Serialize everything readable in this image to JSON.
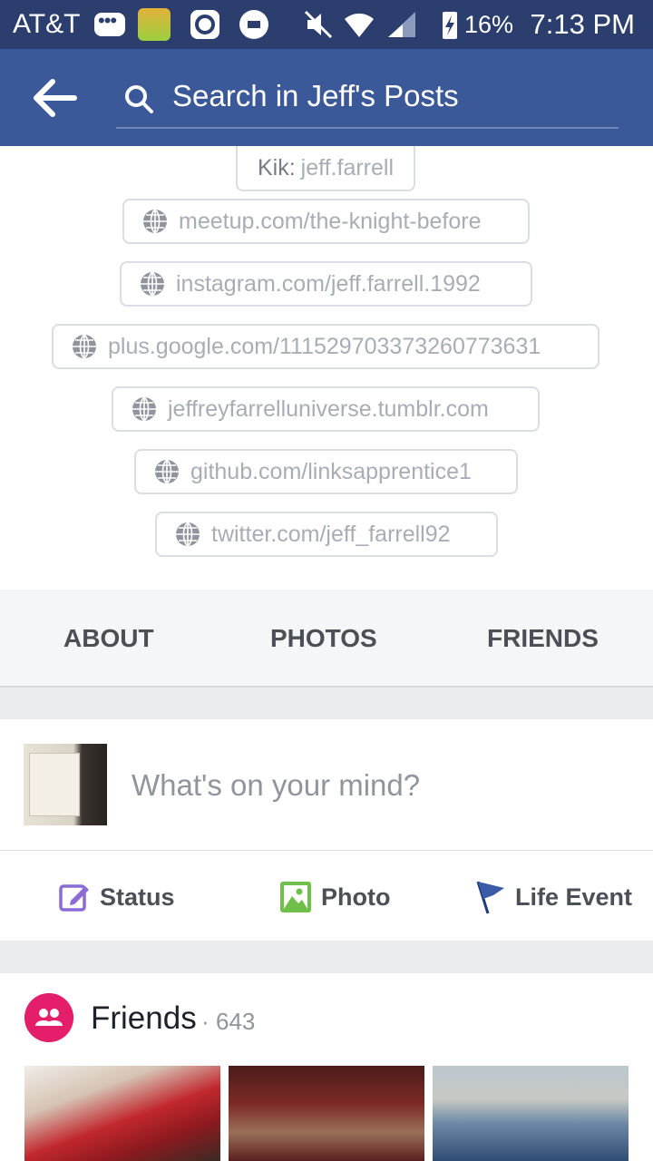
{
  "status_bar": {
    "carrier": "AT&T",
    "battery": "16%",
    "time": "7:13 PM"
  },
  "app_bar": {
    "search_placeholder": "Search in Jeff's Posts"
  },
  "links": {
    "kik_label": "Kik:",
    "kik_value": "jeff.farrell",
    "websites": [
      "meetup.com/the-knight-before",
      "instagram.com/jeff.farrell.1992",
      "plus.google.com/111529703373260773631",
      "jeffreyfarrelluniverse.tumblr.com",
      "github.com/linksapprentice1",
      "twitter.com/jeff_farrell92"
    ]
  },
  "tabs": [
    "ABOUT",
    "PHOTOS",
    "FRIENDS"
  ],
  "composer": {
    "prompt": "What's on your mind?",
    "actions": [
      "Status",
      "Photo",
      "Life Event"
    ]
  },
  "friends": {
    "title": "Friends",
    "separator": "·",
    "count": "643"
  },
  "colors": {
    "app_bar": "#3b5998",
    "status_bar": "#2c3e6d",
    "friends_badge": "#e41e6b",
    "status_icon": "#8b6bd6",
    "photo_icon": "#6fbf4a",
    "life_event_icon": "#3b5ba8"
  }
}
